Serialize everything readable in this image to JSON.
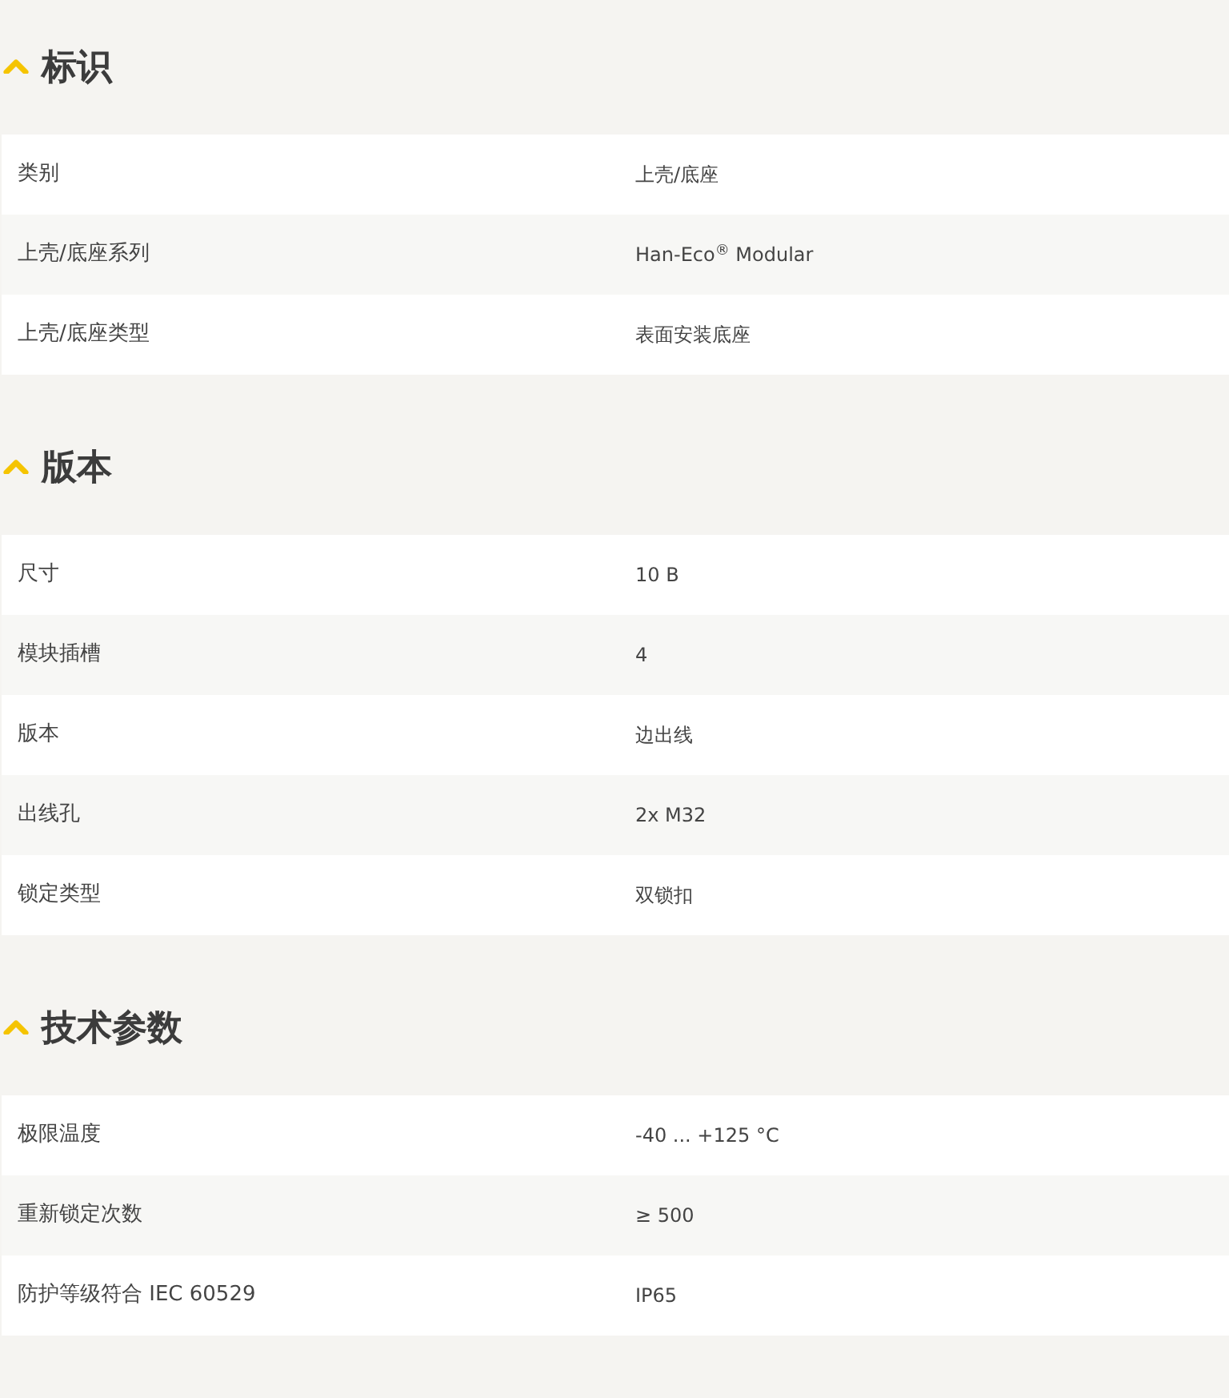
{
  "sections": [
    {
      "title": "标识",
      "expanded": true,
      "rows": [
        {
          "label": "类别",
          "value": "上壳/底座"
        },
        {
          "label": "上壳/底座系列",
          "value": "Han-Eco$^{®}$ Modular"
        },
        {
          "label": "上壳/底座类型",
          "value": "表面安装底座"
        }
      ]
    },
    {
      "title": "版本",
      "expanded": true,
      "rows": [
        {
          "label": "尺寸",
          "value": "10 B"
        },
        {
          "label": "模块插槽",
          "value": "4"
        },
        {
          "label": "版本",
          "value": "边出线"
        },
        {
          "label": "出线孔",
          "value": "2x M32"
        },
        {
          "label": "锁定类型",
          "value": "双锁扣"
        }
      ]
    },
    {
      "title": "技术参数",
      "expanded": true,
      "rows": [
        {
          "label": "极限温度",
          "value": "-40 ... +125 °C"
        },
        {
          "label": "重新锁定次数",
          "value": "≥ 500"
        },
        {
          "label": "防护等级符合 IEC 60529",
          "value": "IP65"
        }
      ]
    }
  ]
}
